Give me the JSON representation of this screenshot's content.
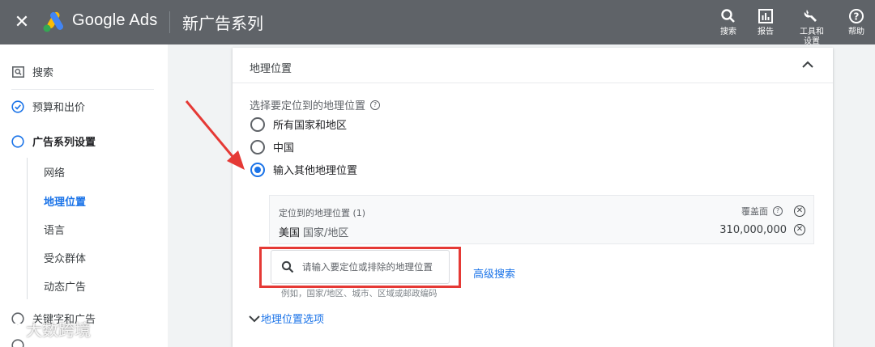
{
  "topbar": {
    "brand": "Google Ads",
    "title": "新广告系列",
    "tools": [
      {
        "label": "搜索",
        "icon": "search-icon"
      },
      {
        "label": "报告",
        "icon": "reports-icon"
      },
      {
        "label": "工具和\n设置",
        "icon": "wrench-icon"
      },
      {
        "label": "帮助",
        "icon": "help-icon"
      }
    ]
  },
  "sidebar": {
    "items": [
      {
        "label": "搜索",
        "icon": "search-box-icon"
      },
      {
        "label": "预算和出价",
        "icon": "check-circle-icon"
      },
      {
        "label": "广告系列设置",
        "icon": "empty-circle-icon"
      },
      {
        "label": "关键字和广告",
        "icon": "empty-circle-icon"
      }
    ],
    "subitems": [
      "网络",
      "地理位置",
      "语言",
      "受众群体",
      "动态广告"
    ],
    "active_sub": "地理位置"
  },
  "card": {
    "title": "地理位置",
    "question": "选择要定位到的地理位置",
    "options": [
      "所有国家和地区",
      "中国",
      "输入其他地理位置"
    ],
    "selected": 2,
    "targeted": {
      "header": "定位到的地理位置 (1)",
      "coverage_label": "覆盖面",
      "rows": [
        {
          "name": "美国",
          "type": "国家/地区",
          "reach": "310,000,000"
        }
      ]
    },
    "search": {
      "placeholder": "请输入要定位或排除的地理位置",
      "hint": "例如，国家/地区、城市、区域或邮政编码"
    },
    "advanced_search": "高级搜索",
    "location_options": "地理位置选项"
  },
  "watermark": "大数跨境",
  "colors": {
    "accent": "#1a73e8",
    "highlight": "#e53935",
    "topbar": "#5f6368"
  }
}
